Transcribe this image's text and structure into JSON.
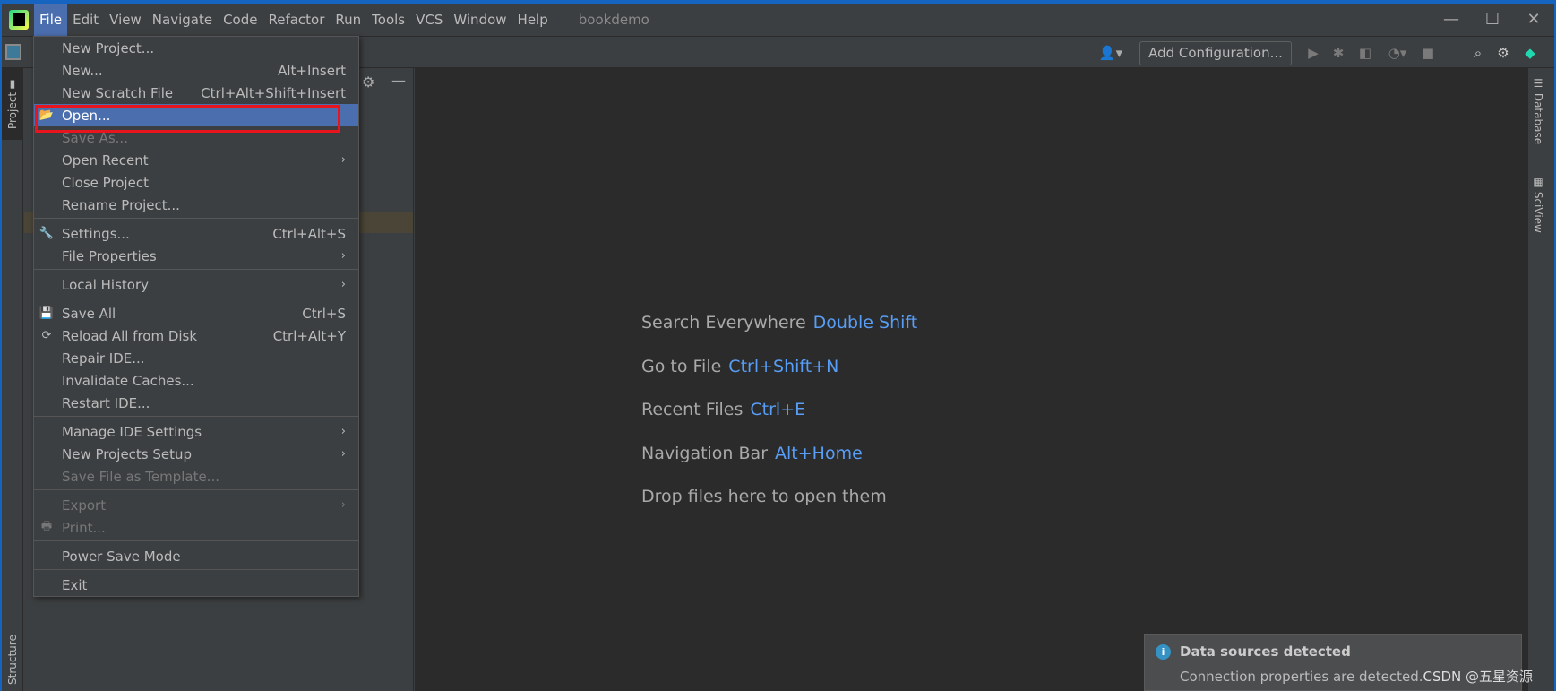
{
  "window": {
    "title": "bookdemo",
    "controls": [
      "minimize",
      "maximize",
      "close"
    ]
  },
  "menubar": [
    "File",
    "Edit",
    "View",
    "Navigate",
    "Code",
    "Refactor",
    "Run",
    "Tools",
    "VCS",
    "Window",
    "Help"
  ],
  "toolbar": {
    "add_configuration": "Add Configuration..."
  },
  "left_tabs": {
    "project": "Project",
    "structure": "Structure"
  },
  "right_tabs": {
    "database": "Database",
    "sciview": "SciView"
  },
  "file_menu": [
    {
      "label": "New Project...",
      "shortcut": ""
    },
    {
      "label": "New...",
      "shortcut": "Alt+Insert"
    },
    {
      "label": "New Scratch File",
      "shortcut": "Ctrl+Alt+Shift+Insert"
    },
    {
      "label": "Open...",
      "shortcut": "",
      "icon": "folder-open-icon",
      "selected": true
    },
    {
      "label": "Save As...",
      "shortcut": "",
      "disabled": true
    },
    {
      "label": "Open Recent",
      "submenu": true
    },
    {
      "label": "Close Project"
    },
    {
      "label": "Rename Project..."
    },
    {
      "sep": true
    },
    {
      "label": "Settings...",
      "shortcut": "Ctrl+Alt+S",
      "icon": "wrench-icon"
    },
    {
      "label": "File Properties",
      "submenu": true
    },
    {
      "sep": true
    },
    {
      "label": "Local History",
      "submenu": true
    },
    {
      "sep": true
    },
    {
      "label": "Save All",
      "shortcut": "Ctrl+S",
      "icon": "save-icon"
    },
    {
      "label": "Reload All from Disk",
      "shortcut": "Ctrl+Alt+Y",
      "icon": "reload-icon"
    },
    {
      "label": "Repair IDE..."
    },
    {
      "label": "Invalidate Caches..."
    },
    {
      "label": "Restart IDE..."
    },
    {
      "sep": true
    },
    {
      "label": "Manage IDE Settings",
      "submenu": true
    },
    {
      "label": "New Projects Setup",
      "submenu": true
    },
    {
      "label": "Save File as Template...",
      "disabled": true
    },
    {
      "sep": true
    },
    {
      "label": "Export",
      "submenu": true,
      "disabled": true
    },
    {
      "label": "Print...",
      "disabled": true,
      "icon": "print-icon"
    },
    {
      "sep": true
    },
    {
      "label": "Power Save Mode"
    },
    {
      "sep": true
    },
    {
      "label": "Exit"
    }
  ],
  "welcome": [
    {
      "label": "Search Everywhere",
      "key": "Double Shift"
    },
    {
      "label": "Go to File",
      "key": "Ctrl+Shift+N"
    },
    {
      "label": "Recent Files",
      "key": "Ctrl+E"
    },
    {
      "label": "Navigation Bar",
      "key": "Alt+Home"
    },
    {
      "label": "Drop files here to open them",
      "key": ""
    }
  ],
  "notification": {
    "title": "Data sources detected",
    "body": "Connection properties are detected.",
    "watermark": "CSDN @五星资源"
  },
  "colors": {
    "accent": "#589df6",
    "selection": "#4b6eaf",
    "highlight_box": "#e8141e"
  }
}
